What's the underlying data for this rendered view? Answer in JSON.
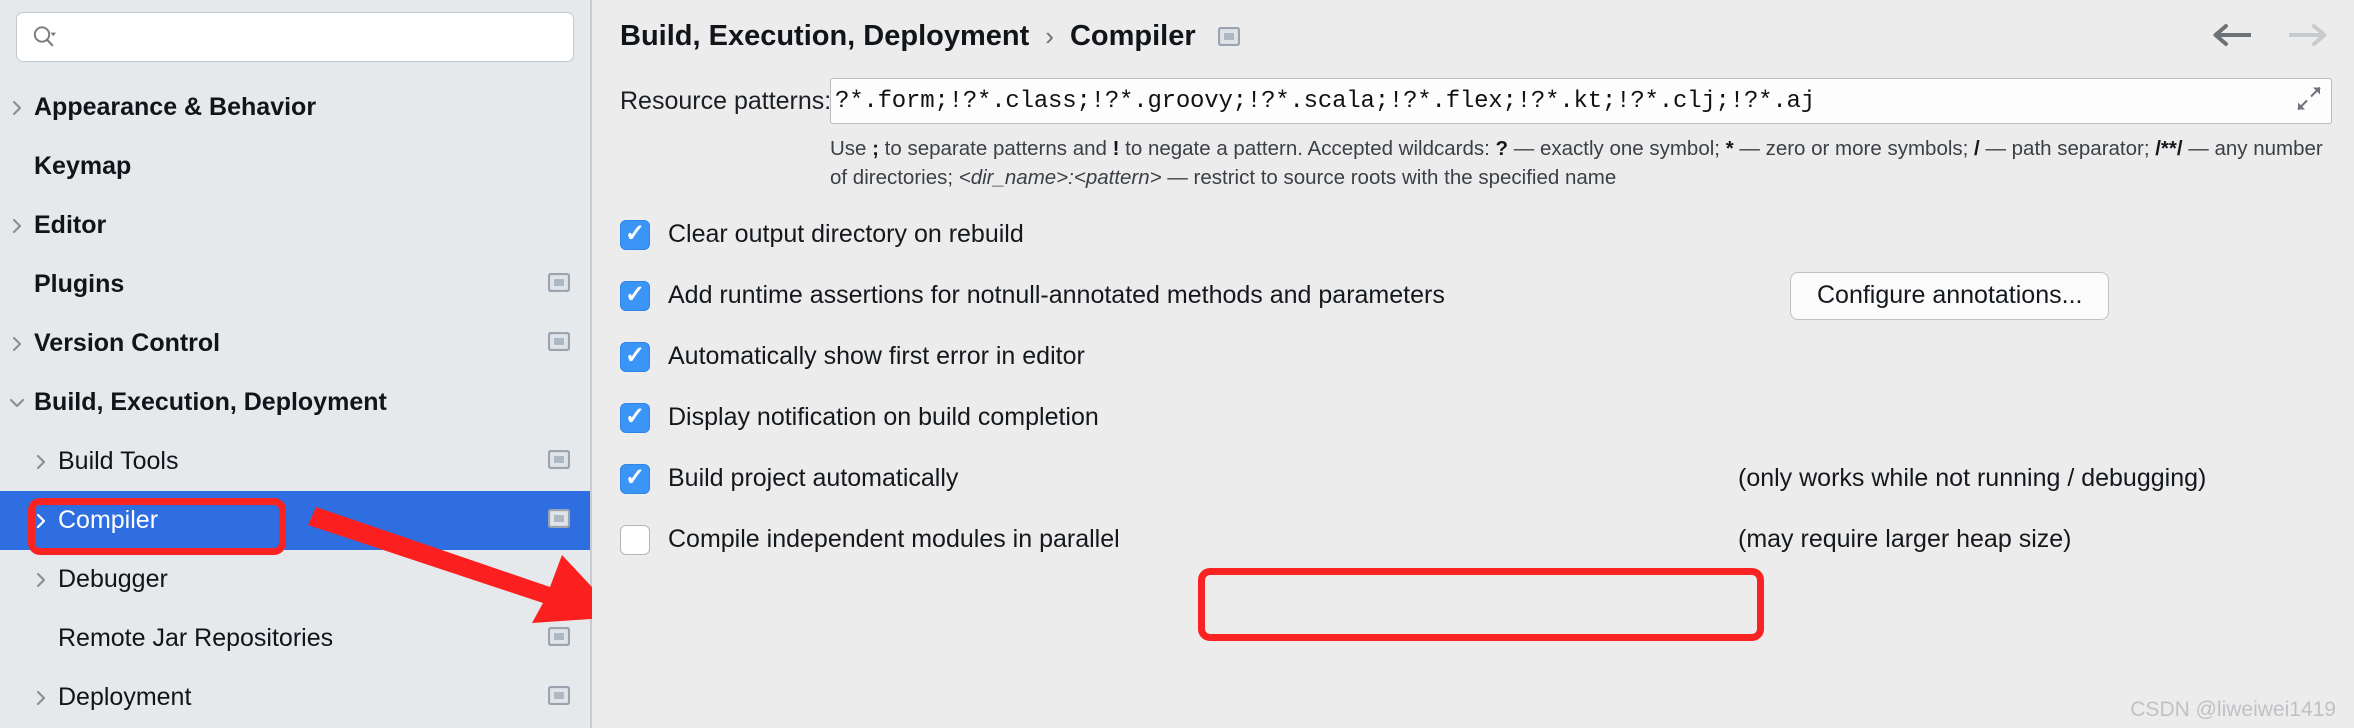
{
  "sidebar": {
    "search": {
      "placeholder": "",
      "value": "",
      "icon": "search-icon"
    },
    "items": [
      {
        "label": "Appearance & Behavior",
        "level": 0,
        "twisty": "right",
        "bold": true,
        "badge": false,
        "selected": false
      },
      {
        "label": "Keymap",
        "level": 0,
        "twisty": "none",
        "bold": true,
        "badge": false,
        "selected": false
      },
      {
        "label": "Editor",
        "level": 0,
        "twisty": "right",
        "bold": true,
        "badge": false,
        "selected": false
      },
      {
        "label": "Plugins",
        "level": 0,
        "twisty": "none",
        "bold": true,
        "badge": true,
        "selected": false
      },
      {
        "label": "Version Control",
        "level": 0,
        "twisty": "right",
        "bold": true,
        "badge": true,
        "selected": false
      },
      {
        "label": "Build, Execution, Deployment",
        "level": 0,
        "twisty": "down",
        "bold": true,
        "badge": false,
        "selected": false
      },
      {
        "label": "Build Tools",
        "level": 1,
        "twisty": "right",
        "bold": false,
        "badge": true,
        "selected": false
      },
      {
        "label": "Compiler",
        "level": 1,
        "twisty": "right",
        "bold": false,
        "badge": true,
        "selected": true
      },
      {
        "label": "Debugger",
        "level": 1,
        "twisty": "right",
        "bold": false,
        "badge": false,
        "selected": false
      },
      {
        "label": "Remote Jar Repositories",
        "level": 1,
        "twisty": "none",
        "bold": false,
        "badge": true,
        "selected": false
      },
      {
        "label": "Deployment",
        "level": 1,
        "twisty": "right",
        "bold": false,
        "badge": true,
        "selected": false
      }
    ]
  },
  "header": {
    "breadcrumb": [
      "Build, Execution, Deployment",
      "Compiler"
    ],
    "separator": "›",
    "badge_icon": "project-settings-icon",
    "back_label": "←",
    "forward_label": "→"
  },
  "main": {
    "resource_patterns": {
      "label": "Resource patterns:",
      "value": "?*.form;!?*.class;!?*.groovy;!?*.scala;!?*.flex;!?*.kt;!?*.clj;!?*.aj",
      "placeholder": "",
      "expand_icon": "expand-diagonal-icon"
    },
    "hint": {
      "p1": "Use ",
      "b1": ";",
      "p2": " to separate patterns and ",
      "b2": "!",
      "p3": " to negate a pattern. Accepted wildcards: ",
      "b3": "?",
      "p4": " — exactly one symbol; ",
      "b4": "*",
      "p5": " — zero or more symbols; ",
      "b5": "/",
      "p6": " — path separator; ",
      "b6": "/**/",
      "p7": " — any number of directories; ",
      "i1": "<dir_name>:<pattern>",
      "p8": " — restrict to source roots with the specified name"
    },
    "options": [
      {
        "label": "Clear output directory on rebuild",
        "checked": true,
        "note": "",
        "button": ""
      },
      {
        "label": "Add runtime assertions for notnull-annotated methods and parameters",
        "checked": true,
        "note": "",
        "button": "Configure annotations..."
      },
      {
        "label": "Automatically show first error in editor",
        "checked": true,
        "note": "",
        "button": ""
      },
      {
        "label": "Display notification on build completion",
        "checked": true,
        "note": "",
        "button": ""
      },
      {
        "label": "Build project automatically",
        "checked": true,
        "note": "(only works while not running / debugging)",
        "button": ""
      },
      {
        "label": "Compile independent modules in parallel",
        "checked": false,
        "note": "(may require larger heap size)",
        "button": ""
      }
    ]
  },
  "annotations": {
    "highlight_color": "#fb2222",
    "selection_color": "#2f6ee0",
    "checkbox_color": "#3b95f6",
    "arrow": "red-arrow-annotation"
  },
  "watermark": {
    "text": "CSDN @liweiwei1419"
  }
}
